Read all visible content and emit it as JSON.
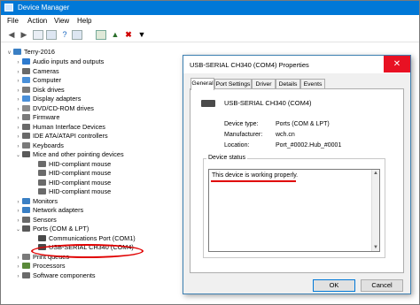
{
  "window": {
    "title": "Device Manager",
    "menu": [
      "File",
      "Action",
      "View",
      "Help"
    ]
  },
  "toolbar": {
    "buttons": [
      "back-icon",
      "forward-icon",
      "properties-icon",
      "help-icon",
      "show-hidden-icon",
      "scan-icon",
      "update-driver-icon",
      "uninstall-icon",
      "disable-icon"
    ]
  },
  "tree": {
    "root": "Terry-2016",
    "items": [
      "Audio inputs and outputs",
      "Cameras",
      "Computer",
      "Disk drives",
      "Display adapters",
      "DVD/CD-ROM drives",
      "Firmware",
      "Human Interface Devices",
      "IDE ATA/ATAPI controllers",
      "Keyboards",
      "Mice and other pointing devices",
      "HID-compliant mouse",
      "HID-compliant mouse",
      "HID-compliant mouse",
      "HID-compliant mouse",
      "Monitors",
      "Network adapters",
      "Sensors",
      "Ports (COM & LPT)",
      "Communications Port (COM1)",
      "USB-SERIAL CH340 (COM4)",
      "Print queues",
      "Processors",
      "Software components"
    ]
  },
  "dialog": {
    "title": "USB-SERIAL CH340 (COM4) Properties",
    "tabs": [
      "General",
      "Port Settings",
      "Driver",
      "Details",
      "Events"
    ],
    "device_name": "USB-SERIAL CH340 (COM4)",
    "device_type_label": "Device type:",
    "device_type": "Ports (COM & LPT)",
    "manufacturer_label": "Manufacturer:",
    "manufacturer": "wch.cn",
    "location_label": "Location:",
    "location": "Port_#0002.Hub_#0001",
    "status_group": "Device status",
    "status_text": "This device is working properly.",
    "ok": "OK",
    "cancel": "Cancel"
  },
  "colors": {
    "accent": "#0078d7",
    "highlight": "#e00000",
    "close": "#e81123"
  }
}
